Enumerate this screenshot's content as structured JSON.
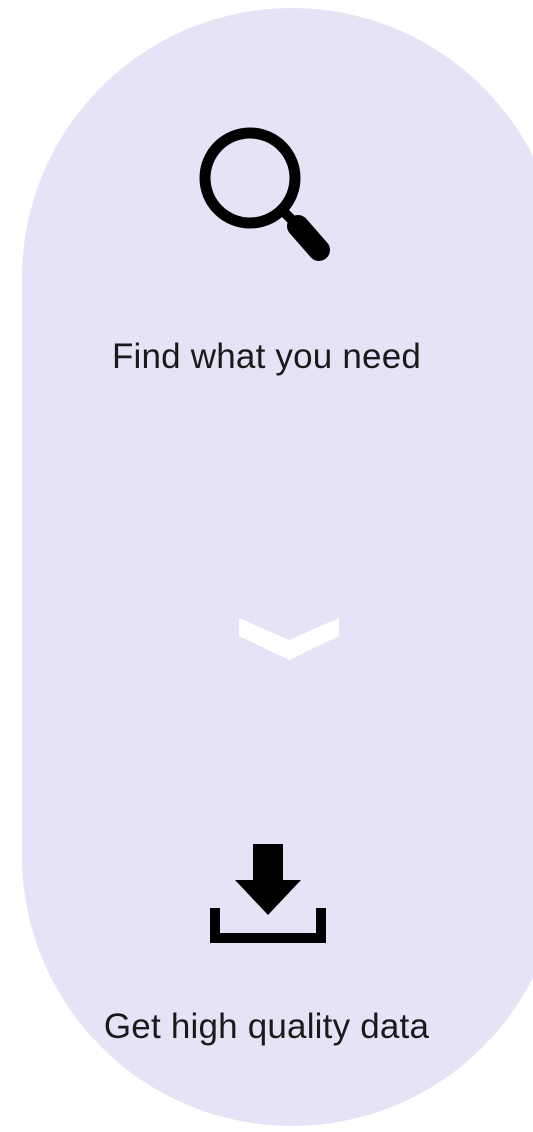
{
  "steps": [
    {
      "icon": "search-icon",
      "label": "Find what you need"
    },
    {
      "icon": "download-icon",
      "label": "Get high quality data"
    }
  ],
  "connector": {
    "icon": "chevron-down-icon"
  },
  "colors": {
    "card_background": "#e6e3f6",
    "icon": "#000000",
    "chevron": "#ffffff",
    "text": "#1a1a1a"
  }
}
